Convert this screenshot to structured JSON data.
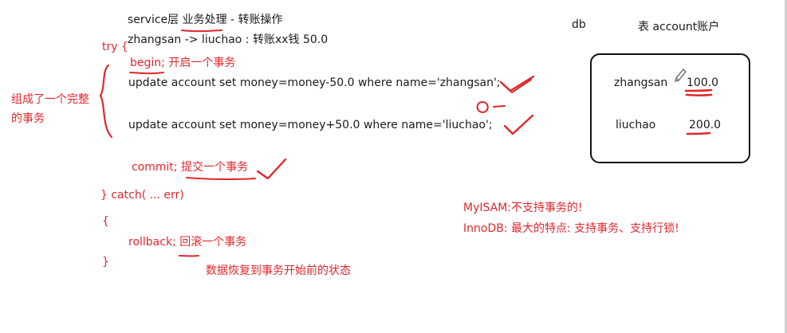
{
  "code": {
    "header": "service层 业务处理 - 转账操作",
    "transfer": "zhangsan -> liuchao :  转账xx钱   50.0",
    "try_open": "try {",
    "begin": "begin;  开启一个事务",
    "update1": "update account set money=money-50.0 where name='zhangsan';",
    "update2": "update account set money=money+50.0 where name='liuchao';",
    "commit": "commit; 提交一个事务",
    "catch": "} catch(  ...           err)",
    "brace_open": "{",
    "rollback": "rollback; 回滚一个事务",
    "brace_close": "}",
    "rollback_note": "数据恢复到事务开始前的状态"
  },
  "side_note": {
    "line1": "组成了一个完整",
    "line2": "的事务"
  },
  "db": {
    "label": "db",
    "table_label": "表 account账户",
    "rows": [
      {
        "name": "zhangsan",
        "money": "100.0"
      },
      {
        "name": "liuchao",
        "money": "200.0"
      }
    ]
  },
  "engine_notes": {
    "myisam": "MyISAM:不支持事务的!",
    "innodb": "InnoDB:  最大的特点:  支持事务、支持行锁!"
  },
  "colors": {
    "ink_red": "#e0272b",
    "ink_black": "#1a1a1a"
  }
}
